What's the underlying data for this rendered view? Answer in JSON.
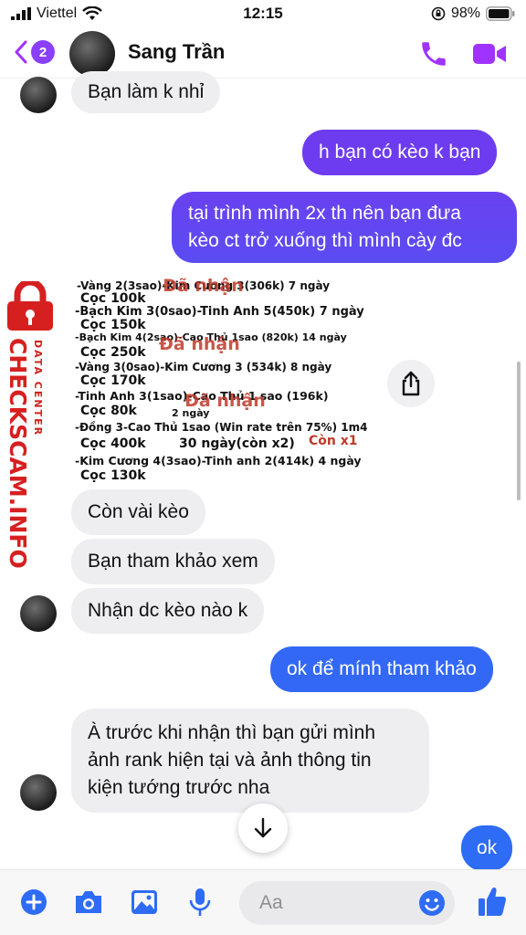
{
  "status_bar": {
    "carrier": "Viettel",
    "time": "12:15",
    "battery": "98%"
  },
  "header": {
    "back_badge": "2",
    "contact_name": "Sang Trần"
  },
  "colors": {
    "accent": "#a033ff",
    "outgoing_bubble_top": "#6d3cf0",
    "outgoing_bubble_bottom": "#2e6cf5",
    "incoming_bubble": "#eeeef0",
    "watermark": "#d62020"
  },
  "messages": [
    {
      "from": "them",
      "text": "Bạn làm k nhỉ"
    },
    {
      "from": "me",
      "text": "h bạn có kèo k bạn"
    },
    {
      "from": "me",
      "lines": [
        "tại trình mình 2x th nên bạn đưa",
        "kèo ct trở xuống thì mình cày đc"
      ]
    },
    {
      "from": "them",
      "text": "Còn vài kèo"
    },
    {
      "from": "them",
      "text": "Bạn tham khảo xem"
    },
    {
      "from": "them",
      "text": "Nhận dc kèo nào k"
    },
    {
      "from": "me",
      "text": "ok để mính tham khảo"
    },
    {
      "from": "them",
      "lines": [
        "À trước khi nhận thì bạn gửi mình",
        "ảnh rank hiện tại và ảnh thông tin",
        "kiện tướng trước nha"
      ]
    },
    {
      "from": "me",
      "text": "ok"
    }
  ],
  "image_message": {
    "lines": [
      "-Vàng 2(3sao)-Kim Cương 3(306k) 7 ngày",
      "Cọc 100k",
      "-Bạch Kim 3(0sao)-Tinh Anh 5(450k) 7 ngày",
      "Cọc 150k",
      "-Bạch Kim 4(2sao)-Cao Thủ 1sao (820k) 14 ngày",
      "Cọc 250k",
      "-Vàng 3(0sao)-Kim Cương 3 (534k) 8 ngày",
      "Cọc 170k",
      "-Tinh Anh 3(1sao)-Cao Thủ 1 sao (196k)",
      "Cọc 80k",
      "2 ngày",
      "-Đồng 3-Cao Thủ 1sao (Win rate trên 75%) 1m4",
      "Cọc 400k",
      "30 ngày(còn x2)",
      "Còn x1",
      "-Kim Cương 4(3sao)-Tinh anh 2(414k) 4 ngày",
      "Cọc 130k"
    ],
    "stamps": [
      "Đã nhận",
      "Đã nhận",
      "Đã nhận"
    ]
  },
  "watermark": {
    "brand": "CHECKSCAM.INFO",
    "tag": "DATA CENTER"
  },
  "composer": {
    "placeholder": "Aa"
  },
  "icons": [
    "signal-icon",
    "wifi-icon",
    "lock-rotation-icon",
    "battery-icon",
    "back-chevron-icon",
    "phone-icon",
    "video-icon",
    "share-icon",
    "scroll-down-icon",
    "plus-icon",
    "camera-icon",
    "photo-icon",
    "microphone-icon",
    "emoji-icon",
    "thumbs-up-icon"
  ]
}
